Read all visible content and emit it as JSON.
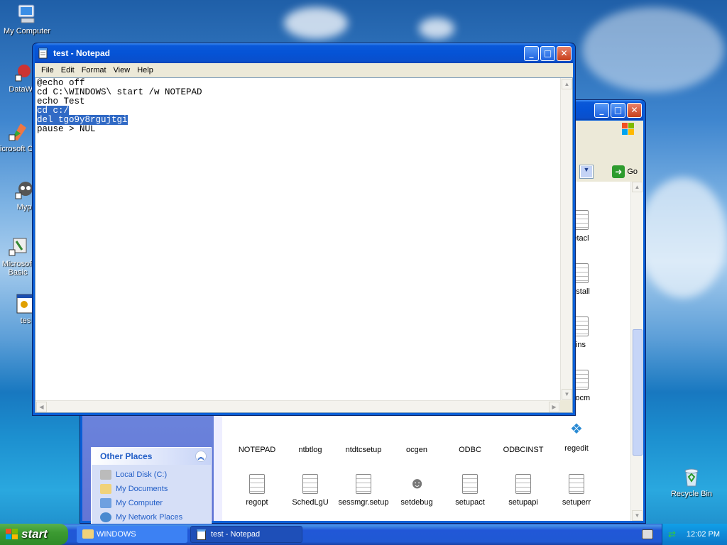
{
  "desktop": {
    "icons": [
      {
        "label": "My Computer"
      },
      {
        "label": "DataWa"
      },
      {
        "label": "Microsoft C++"
      },
      {
        "label": "Myp"
      },
      {
        "label": "Microsoft Basic"
      },
      {
        "label": "tes"
      },
      {
        "label": "Recycle Bin"
      }
    ]
  },
  "notepad": {
    "title": "test - Notepad",
    "menu": [
      "File",
      "Edit",
      "Format",
      "View",
      "Help"
    ],
    "lines_plain": "@echo off\ncd C:\\WINDOWS\\ start /w NOTEPAD\necho Test\n",
    "lines_selected_1": "cd c:/",
    "lines_selected_2": "del tgo9y8rgujtgi",
    "lines_after": "pause > NUL"
  },
  "explorer": {
    "go_label": "Go",
    "other_places_title": "Other Places",
    "other_places": [
      "Local Disk (C:)",
      "My Documents",
      "My Computer",
      "My Network Places"
    ],
    "files_col_right": [
      "etacl",
      "nstall",
      "ins",
      "xocm"
    ],
    "files_row1": [
      "NOTEPAD",
      "ntbtlog",
      "ntdtcsetup",
      "ocgen",
      "ODBC",
      "ODBCINST",
      "regedit"
    ],
    "files_row2": [
      "regopt",
      "SchedLgU",
      "sessmgr.setup",
      "setdebug",
      "setupact",
      "setupapi",
      "setuperr"
    ]
  },
  "taskbar": {
    "start_label": "start",
    "tasks": [
      "WINDOWS",
      "test - Notepad"
    ],
    "clock": "12:02 PM"
  }
}
